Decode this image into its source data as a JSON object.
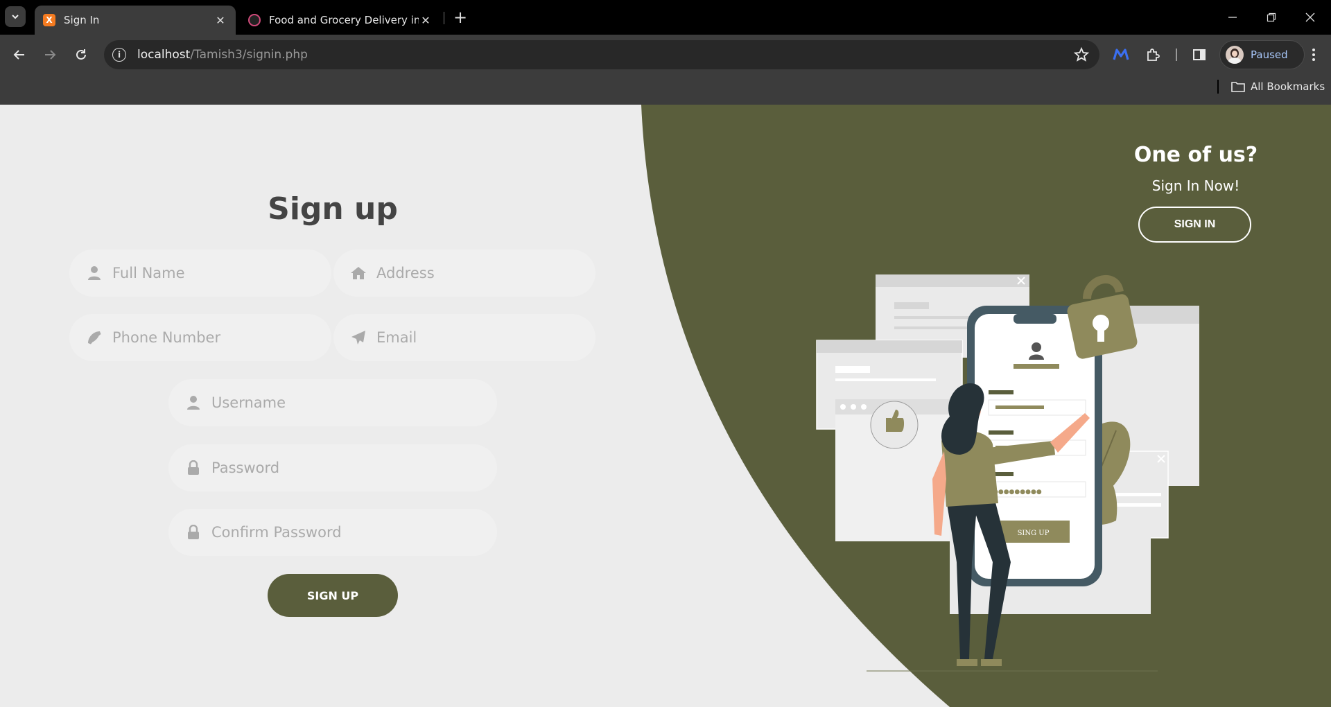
{
  "browser": {
    "tabs": [
      {
        "title": "Sign In",
        "active": true
      },
      {
        "title": "Food and Grocery Delivery in D",
        "active": false
      }
    ],
    "url_host": "localhost",
    "url_path": "/Tamish3/signin.php",
    "profile_label": "Paused",
    "bookmarks_label": "All Bookmarks"
  },
  "signup": {
    "title": "Sign up",
    "fields": {
      "full_name": "Full Name",
      "address": "Address",
      "phone": "Phone Number",
      "email": "Email",
      "username": "Username",
      "password": "Password",
      "confirm_password": "Confirm Password"
    },
    "button": "SIGN UP"
  },
  "signin_panel": {
    "title": "One of us?",
    "subtitle": "Sign In Now!",
    "button": "SIGN IN"
  },
  "illustration": {
    "button_text": "SING UP",
    "password_dots": "●●●●●●●●●"
  },
  "colors": {
    "accent": "#5a5e3c",
    "page_bg": "#ececec",
    "olive_light": "#8f8a5c"
  },
  "icons": [
    "user-icon",
    "home-icon",
    "phone-icon",
    "send-icon",
    "lock-icon"
  ]
}
